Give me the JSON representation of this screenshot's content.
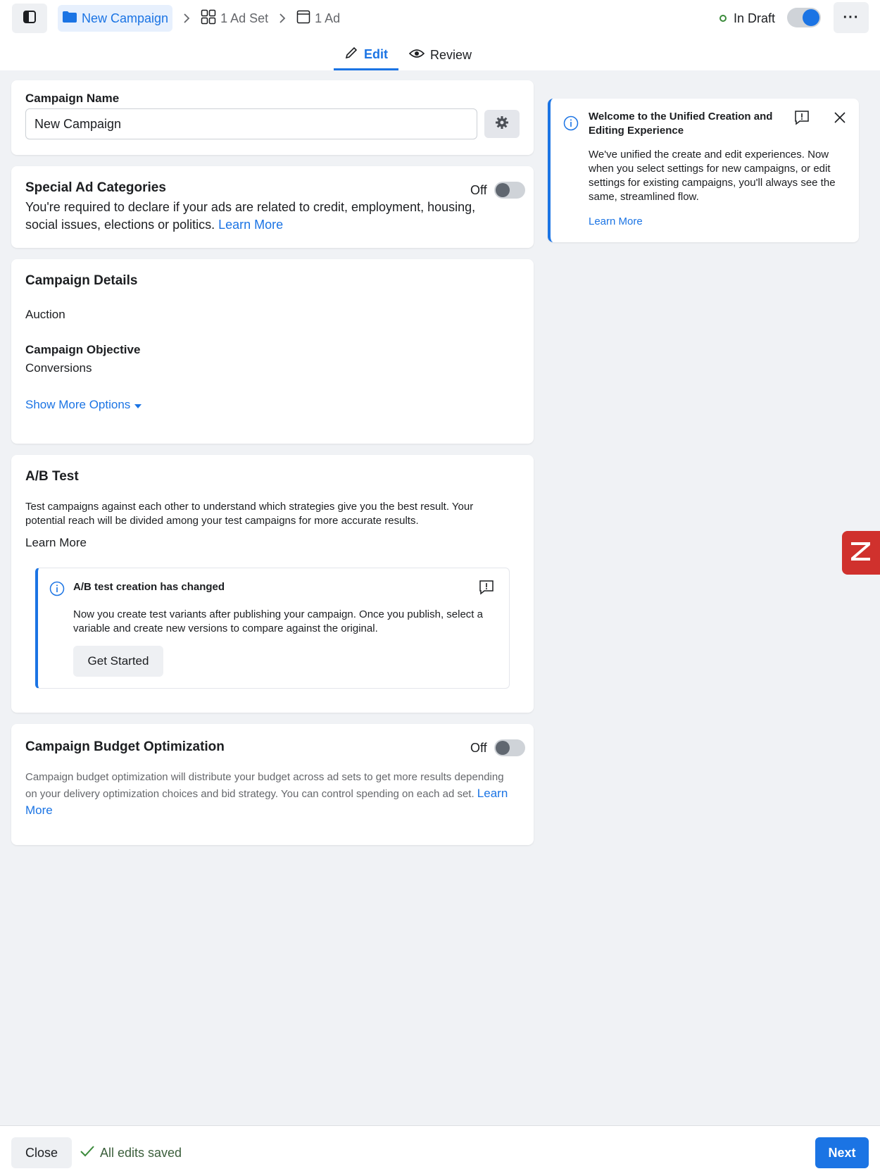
{
  "header": {
    "breadcrumbs": {
      "campaign": "New Campaign",
      "ad_set": "1 Ad Set",
      "ad": "1 Ad"
    },
    "status": "In Draft",
    "tabs": {
      "edit": "Edit",
      "review": "Review"
    }
  },
  "campaign_name": {
    "label": "Campaign Name",
    "value": "New Campaign"
  },
  "special_ad_categories": {
    "title": "Special Ad Categories",
    "toggle_label": "Off",
    "description": "You're required to declare if your ads are related to credit, employment, housing, social issues, elections or politics.",
    "learn_more": "Learn More"
  },
  "campaign_details": {
    "title": "Campaign Details",
    "buying_type": "Auction",
    "objective_label": "Campaign Objective",
    "objective_value": "Conversions",
    "show_more": "Show More Options"
  },
  "ab_test": {
    "title": "A/B Test",
    "description": "Test campaigns against each other to understand which strategies give you the best result. Your potential reach will be divided among your test campaigns for more accurate results.",
    "learn_more": "Learn More",
    "notice": {
      "title": "A/B test creation has changed",
      "body": "Now you create test variants after publishing your campaign. Once you publish, select a variable and create new versions to compare against the original.",
      "button": "Get Started"
    }
  },
  "budget_optimization": {
    "title": "Campaign Budget Optimization",
    "toggle_label": "Off",
    "description": "Campaign budget optimization will distribute your budget across ad sets to get more results depending on your delivery optimization choices and bid strategy. You can control spending on each ad set.",
    "learn_more": "Learn More"
  },
  "side_notice": {
    "title": "Welcome to the Unified Creation and Editing Experience",
    "body": "We've unified the create and edit experiences. Now when you select settings for new campaigns, or edit settings for existing campaigns, you'll always see the same, streamlined flow.",
    "learn_more": "Learn More"
  },
  "footer": {
    "close": "Close",
    "saved": "All edits saved",
    "next": "Next"
  },
  "colors": {
    "accent": "#1b74e4",
    "danger": "#d0312d"
  }
}
